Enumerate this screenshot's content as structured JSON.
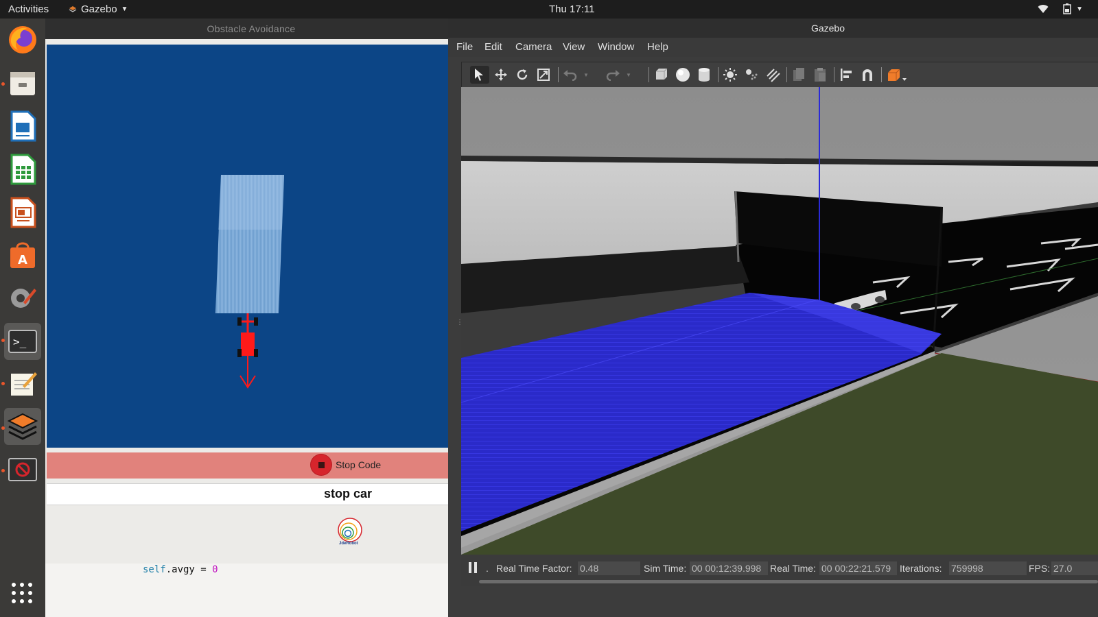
{
  "topbar": {
    "activities": "Activities",
    "app_name": "Gazebo",
    "clock": "Thu 17:11"
  },
  "dock": {
    "items": [
      "firefox-icon",
      "files-icon",
      "writer-icon",
      "calc-icon",
      "impress-icon",
      "software-center-icon",
      "settings-icon",
      "terminal-icon",
      "text-editor-icon",
      "gazebo-icon",
      "no-entry-icon"
    ]
  },
  "obstacle_window": {
    "title": "Obstacle Avoidance",
    "stop_button_label": "Stop Code",
    "status_text": "stop car",
    "logo_text": "JdeRobot",
    "code_line_obj": "self",
    "code_line_attr": ".avgy = ",
    "code_line_value": "0",
    "canvas_bg": "#0c4586"
  },
  "gazebo_window": {
    "title": "Gazebo",
    "menu": [
      "File",
      "Edit",
      "Camera",
      "View",
      "Window",
      "Help"
    ],
    "status": {
      "rtf_label": "Real Time Factor:",
      "rtf_value": "0.48",
      "sim_time_label": "Sim Time:",
      "sim_time_value": "00 00:12:39.998",
      "real_time_label": "Real Time:",
      "real_time_value": "00 00:22:21.579",
      "iterations_label": "Iterations:",
      "iterations_value": "759998",
      "fps_label": "FPS:",
      "fps_value": "27.0"
    },
    "pause_marker": "."
  }
}
